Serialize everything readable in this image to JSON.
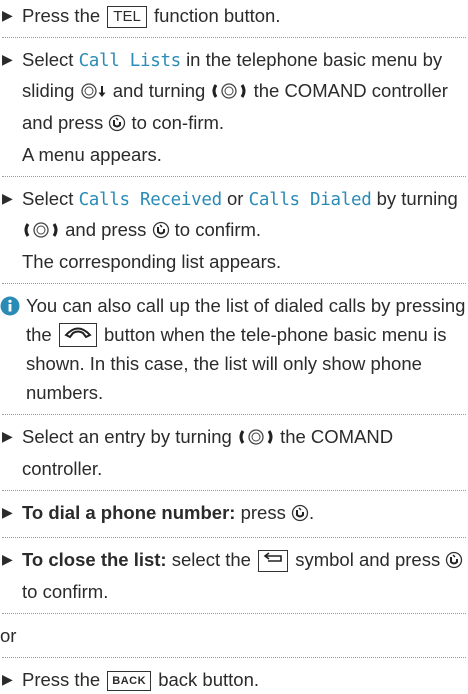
{
  "instructions": {
    "s1": {
      "pre": "Press the",
      "button": "TEL",
      "post": "function button."
    },
    "s2": {
      "pre": "Select",
      "menu_item": "Call Lists",
      "mid1": "in the telephone basic menu by sliding",
      "mid2": "and turning",
      "mid3": "the COMAND controller and press",
      "post": "to con-firm.",
      "result": "A menu appears."
    },
    "s3": {
      "pre": "Select",
      "option1": "Calls Received",
      "or": "or",
      "option2": "Calls Dialed",
      "mid": "by turning",
      "mid2": "and press",
      "post": "to confirm.",
      "result": "The corresponding list appears."
    },
    "note": {
      "pre": "You can also call up the list of dialed calls by pressing the",
      "post": "button when the tele-phone basic menu is shown. In this case, the list will only show phone numbers."
    },
    "s4": {
      "pre": "Select an entry by turning",
      "post": "the COMAND controller."
    },
    "s5": {
      "bold": "To dial a phone number:",
      "post": "press"
    },
    "s6": {
      "bold": "To close the list:",
      "mid": "select the",
      "mid2": "symbol and press",
      "post": "to confirm."
    },
    "or_line": "or",
    "s7": {
      "pre": "Press the",
      "button": "BACK",
      "post": "back button."
    }
  },
  "colors": {
    "accent": "#2a8bb7",
    "text": "#2b2b2b",
    "separator": "#9a9a9a"
  },
  "icons": {
    "bullet": "triangle-bullet",
    "slide_down": "controller-slide-down-icon",
    "turn": "controller-turn-icon",
    "press": "controller-press-icon",
    "info": "info-icon",
    "phone": "phone-handset-icon",
    "back_symbol": "back-arrow-icon"
  }
}
